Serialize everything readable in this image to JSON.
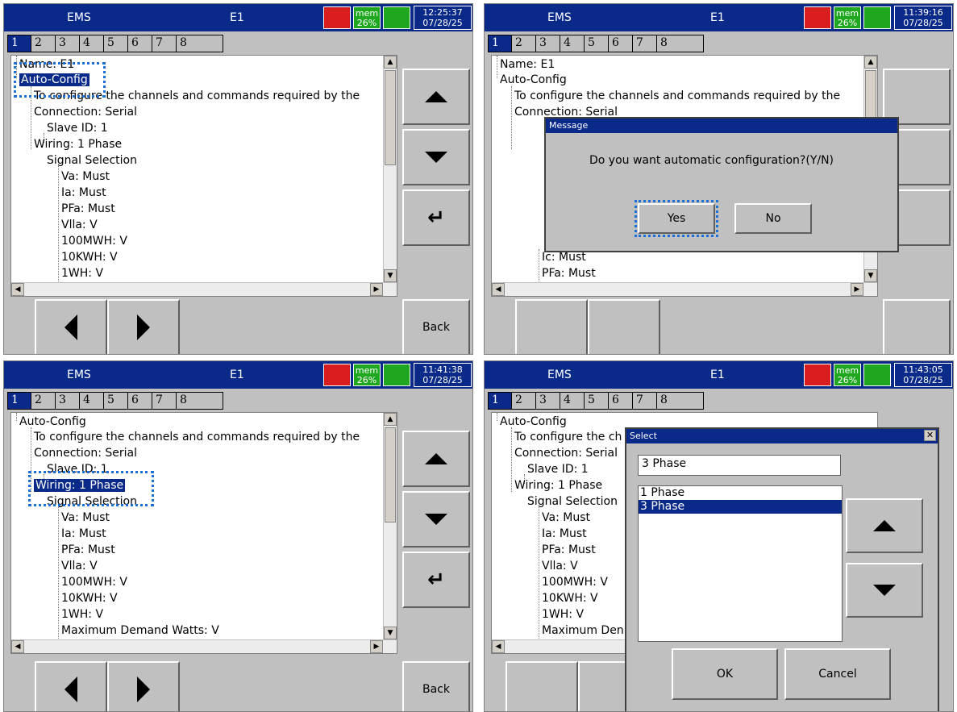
{
  "header": {
    "app": "EMS",
    "device": "E1",
    "mem_label": "mem",
    "mem_value": "26%"
  },
  "clocks": [
    {
      "time": "12:25:37",
      "date": "07/28/25"
    },
    {
      "time": "11:39:16",
      "date": "07/28/25"
    },
    {
      "time": "11:41:38",
      "date": "07/28/25"
    },
    {
      "time": "11:43:05",
      "date": "07/28/25"
    }
  ],
  "tabs": [
    "1",
    "2",
    "3",
    "4",
    "5",
    "6",
    "7",
    "8"
  ],
  "tree_top": [
    "Name: E1",
    "Auto-Config",
    "To configure the channels and commands required by the",
    "Connection: Serial",
    "Slave ID: 1",
    "Wiring: 1 Phase",
    "Signal Selection",
    "Va: Must",
    "Ia: Must",
    "PFa: Must",
    "Vlla: V",
    "100MWH: V",
    "10KWH: V",
    "1WH: V"
  ],
  "tree_msg_tail": [
    "Ic: Must",
    "PFa: Must"
  ],
  "tree_bottom": [
    "Auto-Config",
    "To configure the channels and commands required by the",
    "Connection: Serial",
    "Slave ID: 1",
    "Wiring: 1 Phase",
    "Signal Selection",
    "Va: Must",
    "Ia: Must",
    "PFa: Must",
    "Vlla: V",
    "100MWH: V",
    "10KWH: V",
    "1WH: V",
    "Maximum Demand Watts: V"
  ],
  "tree_select": [
    "Auto-Config",
    "To configure the ch",
    "Connection: Serial",
    "Slave ID: 1",
    "Wiring: 1 Phase",
    "Signal Selection",
    "Va: Must",
    "Ia: Must",
    "PFa: Must",
    "Vlla: V",
    "100MWH: V",
    "10KWH: V",
    "1WH: V",
    "Maximum Den"
  ],
  "buttons": {
    "back": "Back"
  },
  "message_dialog": {
    "title": "Message",
    "text": "Do you want automatic configuration?(Y/N)",
    "yes": "Yes",
    "no": "No"
  },
  "select_dialog": {
    "title": "Select",
    "value": "3 Phase",
    "options": [
      "1 Phase",
      "3 Phase"
    ],
    "selected": "3 Phase",
    "ok": "OK",
    "cancel": "Cancel"
  },
  "colors": {
    "titlebar": "#0a2a8a",
    "selection": "#0a2a8a",
    "focus": "#1a6fd8",
    "panel": "#c0c0c0"
  }
}
